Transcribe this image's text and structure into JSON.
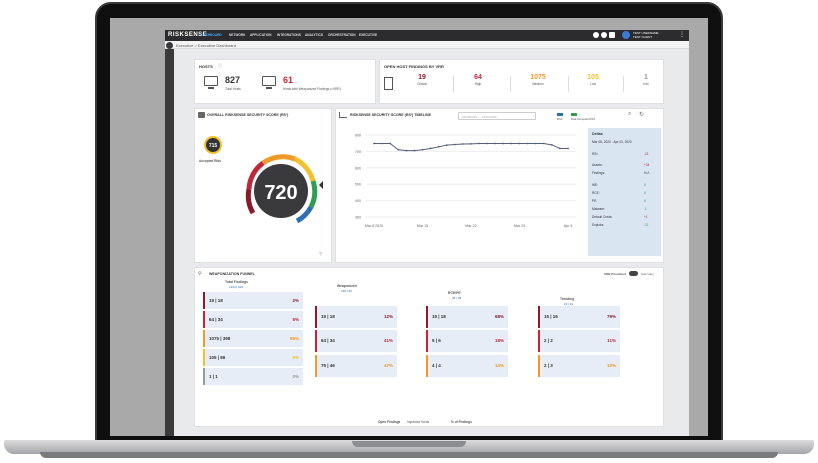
{
  "topbar": {
    "logo": "RISKSENSE",
    "nav": [
      "DASHBOARD",
      "NETWORK",
      "APPLICATION",
      "INTEGRATIONS",
      "ANALYTICS",
      "ORCHESTRATION",
      "EXECUTIVE"
    ],
    "user_name": "TEST USERNAME",
    "user_sub": "TEST CLIENT"
  },
  "breadcrumb": "Executive > Executive Dashboard",
  "hosts": {
    "title": "HOSTS",
    "total": "827",
    "total_label": "Total Hosts",
    "weaponized": "61",
    "weaponized_label": "Hosts with Weaponized Findings (>VRR)"
  },
  "vrr": {
    "title": "OPEN HOST FINDINGS BY VRR",
    "items": [
      {
        "value": "19",
        "label": "Critical",
        "color": "#8b1a2b"
      },
      {
        "value": "64",
        "label": "High",
        "color": "#c0283a"
      },
      {
        "value": "1075",
        "label": "Medium",
        "color": "#f09a2a"
      },
      {
        "value": "105",
        "label": "Low",
        "color": "#f2c12e"
      },
      {
        "value": "1",
        "label": "Info",
        "color": "#9a9a9a"
      }
    ]
  },
  "rs3": {
    "title": "OVERALL RISKSENSE SECURITY SCORE (RS³)",
    "accepted_value": "715",
    "accepted_label": "Accepted Risk",
    "score": "720"
  },
  "timeline": {
    "title": "RISKSENSE SECURITY SCORE (RS³) TIMELINE",
    "date_from": "03/08/2020",
    "date_to": "04/07/2020",
    "legend_rs3": "RS3",
    "legend_accepted": "Risk Accepted RS3",
    "panel": {
      "title": "Deltas",
      "range": "Mar 08, 2020 - Apr 03, 2020",
      "rows": [
        {
          "label": "RS³:",
          "value": "-21",
          "color": "#c0283a"
        },
        {
          "label": "Assets:",
          "value": "+34",
          "color": "#c0283a"
        },
        {
          "label": "Findings:",
          "value": "N/A",
          "color": "#555"
        },
        {
          "label": "WE:",
          "value": "0",
          "color": "#2e9e4f"
        },
        {
          "label": "RCE:",
          "value": "0",
          "color": "#2e9e4f"
        },
        {
          "label": "PE:",
          "value": "0",
          "color": "#2e9e4f"
        },
        {
          "label": "Malware:",
          "value": "-1",
          "color": "#2e9e4f"
        },
        {
          "label": "Default Creds:",
          "value": "+1",
          "color": "#c0283a"
        },
        {
          "label": "Exploits:",
          "value": "-21",
          "color": "#2e9e4f"
        }
      ]
    }
  },
  "chart_data": {
    "type": "line",
    "title": "RISKSENSE SECURITY SCORE (RS³) TIMELINE",
    "xlabel": "",
    "ylabel": "",
    "ylim": [
      300,
      800
    ],
    "yticks": [
      "800",
      "700",
      "600",
      "500",
      "400",
      "300"
    ],
    "xtick_labels": [
      "Mar 8 2020",
      "Mar 15",
      "Mar 22",
      "Mar 29",
      "Apr 5"
    ],
    "series": [
      {
        "values": [
          748,
          748,
          748,
          710,
          705,
          705,
          710,
          718,
          728,
          738,
          742,
          745,
          746,
          748,
          748,
          748,
          748,
          748,
          748,
          748,
          748,
          748,
          740,
          718,
          718
        ]
      }
    ]
  },
  "funnel": {
    "title": "WEAPONIZATION FUNNEL",
    "toggle_left": "VRR Prioritized",
    "toggle_right": "Summary",
    "stages": [
      {
        "title": "Total Findings",
        "sub": "1264 | 916",
        "rows": [
          {
            "text": "19 | 18",
            "pct": "2%",
            "color": "#8b1a2b"
          },
          {
            "text": "64 | 34",
            "pct": "5%",
            "color": "#c0283a"
          },
          {
            "text": "1075 | 398",
            "pct": "85%",
            "color": "#f09a2a"
          },
          {
            "text": "105 | 86",
            "pct": "8%",
            "color": "#f2c12e"
          },
          {
            "text": "1 | 1",
            "pct": "0%",
            "color": "#9a9a9a"
          }
        ]
      },
      {
        "title": "Weaponized",
        "sub": "158 | 96",
        "rows": [
          {
            "text": "19 | 18",
            "pct": "12%",
            "color": "#8b1a2b"
          },
          {
            "text": "64 | 34",
            "pct": "41%",
            "color": "#c0283a"
          },
          {
            "text": "75 | 46",
            "pct": "47%",
            "color": "#f09a2a"
          }
        ]
      },
      {
        "title": "RCE/PE",
        "sub": "28 | 28",
        "rows": [
          {
            "text": "19 | 18",
            "pct": "68%",
            "color": "#8b1a2b"
          },
          {
            "text": "5 | 6",
            "pct": "18%",
            "color": "#c0283a"
          },
          {
            "text": "4 | 4",
            "pct": "14%",
            "color": "#f09a2a"
          }
        ]
      },
      {
        "title": "Trending",
        "sub": "19 | 21",
        "rows": [
          {
            "text": "15 | 16",
            "pct": "79%",
            "color": "#8b1a2b"
          },
          {
            "text": "2 | 2",
            "pct": "11%",
            "color": "#c0283a"
          },
          {
            "text": "2 | 3",
            "pct": "10%",
            "color": "#f09a2a"
          }
        ]
      }
    ],
    "footer_a": "Open Findings",
    "footer_b": "Impacted Hosts",
    "footer_c": "% of Findings"
  }
}
